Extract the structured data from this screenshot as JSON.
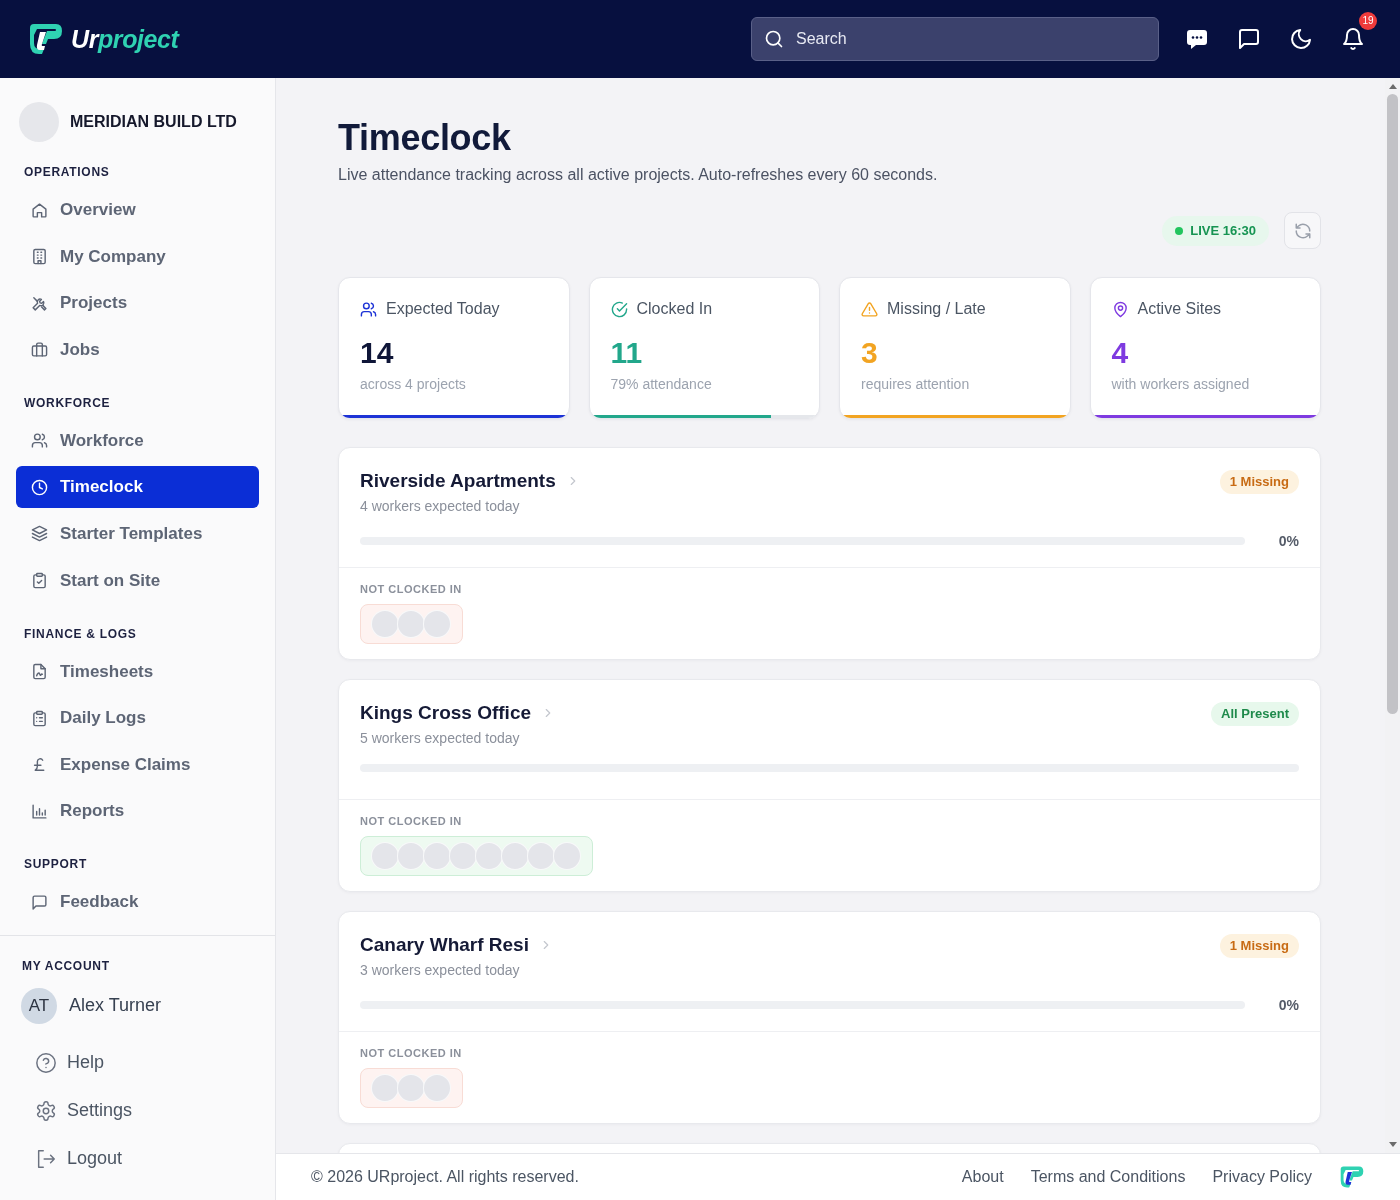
{
  "header": {
    "logo_text": "**Ur**project",
    "search": {
      "placeholder": "Search"
    },
    "notification_count": "19"
  },
  "sidebar": {
    "company": {
      "name": "MERIDIAN BUILD LTD"
    },
    "sections": [
      {
        "heading": "OPERATIONS",
        "items": [
          {
            "label": "Overview",
            "selected": false
          },
          {
            "label": "My Company",
            "selected": false
          },
          {
            "label": "Projects",
            "selected": false
          },
          {
            "label": "Jobs",
            "selected": false
          }
        ]
      },
      {
        "heading": "WORKFORCE",
        "items": [
          {
            "label": "Workforce",
            "selected": false
          },
          {
            "label": "Timeclock",
            "selected": true
          },
          {
            "label": "Starter Templates",
            "selected": false
          },
          {
            "label": "Start on Site",
            "selected": false
          }
        ]
      },
      {
        "heading": "FINANCE & LOGS",
        "items": [
          {
            "label": "Timesheets",
            "selected": false
          },
          {
            "label": "Daily Logs",
            "selected": false
          },
          {
            "label": "Expense Claims",
            "selected": false
          },
          {
            "label": "Reports",
            "selected": false
          }
        ]
      },
      {
        "heading": "SUPPORT",
        "items": [
          {
            "label": "Feedback",
            "selected": false
          }
        ]
      }
    ],
    "account": {
      "heading": "MY ACCOUNT",
      "user": {
        "initials": "AT",
        "name": "Alex Turner"
      },
      "items": [
        {
          "label": "Help"
        },
        {
          "label": "Settings"
        },
        {
          "label": "Logout"
        }
      ]
    }
  },
  "page": {
    "title": "Timeclock",
    "subtitle": "Live attendance tracking across all active projects. Auto-refreshes every 60 seconds.",
    "live_label": "LIVE 16:30"
  },
  "stats": [
    {
      "kind": "neutral",
      "label": "Expected Today",
      "value": "14",
      "note": "across 4 projects",
      "color": "#1d33d6",
      "level": 1
    },
    {
      "kind": "accent",
      "label": "Clocked In",
      "value": "11",
      "note": "79% attendance",
      "color": "#22a78b",
      "level": 0.79
    },
    {
      "kind": "accent",
      "label": "Missing / Late",
      "value": "3",
      "note": "requires attention",
      "color": "#f2a422",
      "level": 1
    },
    {
      "kind": "accent",
      "label": "Active Sites",
      "value": "4",
      "note": "with workers assigned",
      "color": "#7e3ae0",
      "level": 1
    }
  ],
  "sites": [
    {
      "kind": "missing",
      "name": "Riverside Apartments",
      "expected": "4 workers expected today",
      "badge": "1 Missing",
      "level": 0,
      "percent": "0%",
      "section_label": "NOT CLOCKED IN",
      "avatars": [
        {
          "kind": "placeholder"
        },
        {
          "kind": "placeholder"
        },
        {
          "kind": "placeholder"
        }
      ]
    },
    {
      "kind": "present",
      "name": "Kings Cross Office",
      "expected": "5 workers expected today",
      "badge": "All Present",
      "level": 0,
      "section_label": "NOT CLOCKED IN",
      "avatars": [
        {
          "kind": "placeholder"
        },
        {
          "kind": "placeholder"
        },
        {
          "kind": "placeholder"
        },
        {
          "kind": "placeholder"
        },
        {
          "kind": "placeholder"
        },
        {
          "kind": "placeholder"
        },
        {
          "kind": "placeholder"
        },
        {
          "kind": "placeholder"
        }
      ]
    },
    {
      "kind": "missing",
      "name": "Canary Wharf Resi",
      "expected": "3 workers expected today",
      "badge": "1 Missing",
      "level": 0,
      "percent": "0%",
      "section_label": "NOT CLOCKED IN",
      "avatars": [
        {
          "kind": "placeholder"
        },
        {
          "kind": "placeholder"
        },
        {
          "kind": "placeholder"
        }
      ]
    }
  ],
  "clipped_site_card": true,
  "footer": {
    "copyright": "© 2026 URproject. All rights reserved.",
    "links": [
      "About",
      "Terms and Conditions",
      "Privacy Policy"
    ]
  }
}
